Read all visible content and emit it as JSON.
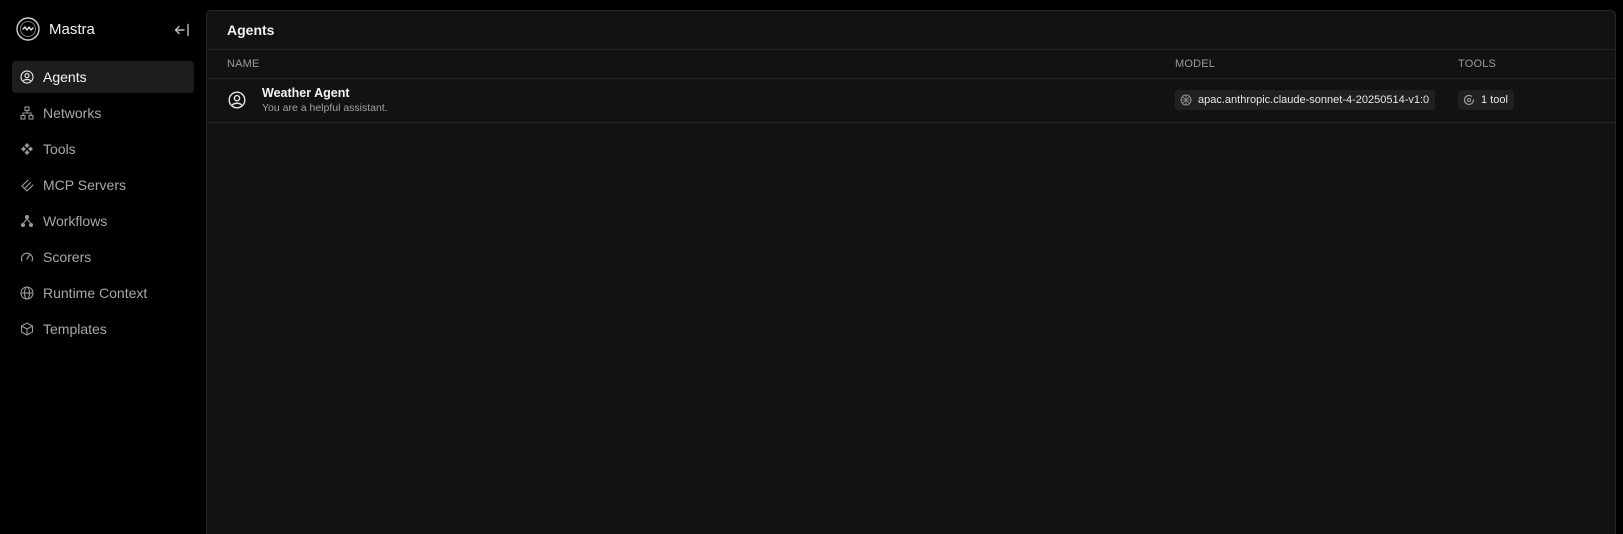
{
  "app": {
    "name": "Mastra"
  },
  "icons": {
    "logo": "mastra-logo-icon",
    "collapse": "collapse-sidebar-icon"
  },
  "sidebar": {
    "items": [
      {
        "label": "Agents",
        "icon": "agent-icon",
        "active": true
      },
      {
        "label": "Networks",
        "icon": "network-icon",
        "active": false
      },
      {
        "label": "Tools",
        "icon": "tools-icon",
        "active": false
      },
      {
        "label": "MCP Servers",
        "icon": "mcp-icon",
        "active": false
      },
      {
        "label": "Workflows",
        "icon": "workflow-icon",
        "active": false
      },
      {
        "label": "Scorers",
        "icon": "gauge-icon",
        "active": false
      },
      {
        "label": "Runtime Context",
        "icon": "globe-icon",
        "active": false
      },
      {
        "label": "Templates",
        "icon": "package-icon",
        "active": false
      }
    ]
  },
  "main": {
    "title": "Agents",
    "columns": {
      "name": "NAME",
      "model": "MODEL",
      "tools": "TOOLS"
    },
    "rows": [
      {
        "name": "Weather Agent",
        "description": "You are a helpful assistant.",
        "model": "apac.anthropic.claude-sonnet-4-20250514-v1:0",
        "tools": "1 tool"
      }
    ]
  },
  "colors": {
    "background": "#000000",
    "panel": "#121212",
    "border": "#262626",
    "active_item": "#1d1d1d",
    "text_primary": "#f5f5f5",
    "text_muted": "#a8a8a8"
  }
}
